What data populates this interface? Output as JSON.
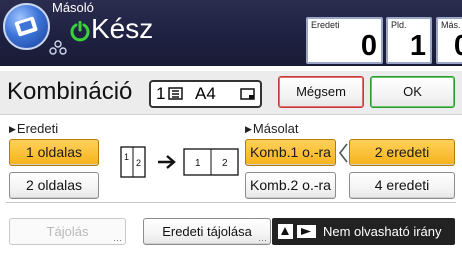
{
  "header": {
    "app_name": "Másoló",
    "status": "Kész",
    "counters": [
      {
        "label": "Eredeti",
        "value": "0"
      },
      {
        "label": "Pld.",
        "value": "1"
      },
      {
        "label": "Más.",
        "value": "0"
      }
    ]
  },
  "title_row": {
    "title": "Kombináció",
    "summary": {
      "count": "1",
      "paper": "A4"
    },
    "cancel_label": "Mégsem",
    "ok_label": "OK"
  },
  "original": {
    "label": "Eredeti",
    "options": [
      "1 oldalas",
      "2 oldalas"
    ],
    "selected": "1 oldalas"
  },
  "diagram": {
    "from_pages": [
      "1",
      "2"
    ],
    "to_pages": [
      "1",
      "2"
    ]
  },
  "copy": {
    "label": "Másolat",
    "options": [
      "Komb.1 o.-ra",
      "Komb.2 o.-ra"
    ],
    "selected": "Komb.1 o.-ra",
    "originals_options": [
      "2 eredeti",
      "4 eredeti"
    ],
    "originals_selected": "2 eredeti"
  },
  "bottom": {
    "orientation_label": "Tájolás",
    "original_orientation_label": "Eredeti tájolása",
    "readable_direction_label": "Nem olvasható irány"
  },
  "colors": {
    "selected": "#f6b21a",
    "header_bg": "#1f2142",
    "cancel_border": "#c73838",
    "ok_border": "#2c9a2c"
  }
}
